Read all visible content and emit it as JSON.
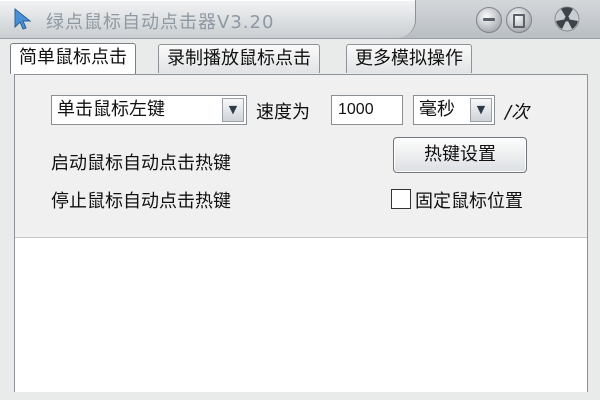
{
  "window": {
    "title": "绿点鼠标自动点击器V3.20"
  },
  "icons": {
    "app": "mouse-pointer-icon",
    "minimize": "minimize-icon",
    "maximize": "maximize-icon",
    "close": "radiation-close-icon"
  },
  "tabs": [
    {
      "label": "简单鼠标点击",
      "active": true
    },
    {
      "label": "录制播放鼠标点击",
      "active": false
    },
    {
      "label": "更多模拟操作",
      "active": false
    }
  ],
  "main": {
    "click_type": "单击鼠标左键",
    "speed_label": "速度为",
    "speed_value": "1000",
    "unit": "毫秒",
    "per_label": "/次",
    "start_hotkey_label": "启动鼠标自动点击热键",
    "stop_hotkey_label": "停止鼠标自动点击热键",
    "hotkey_button": "热键设置",
    "fix_position_label": "固定鼠标位置",
    "fix_position_checked": false
  },
  "colors": {
    "window_bg": "#e9eaea",
    "panel_bg": "#f0f0f0",
    "title_text": "#8f99a3"
  }
}
